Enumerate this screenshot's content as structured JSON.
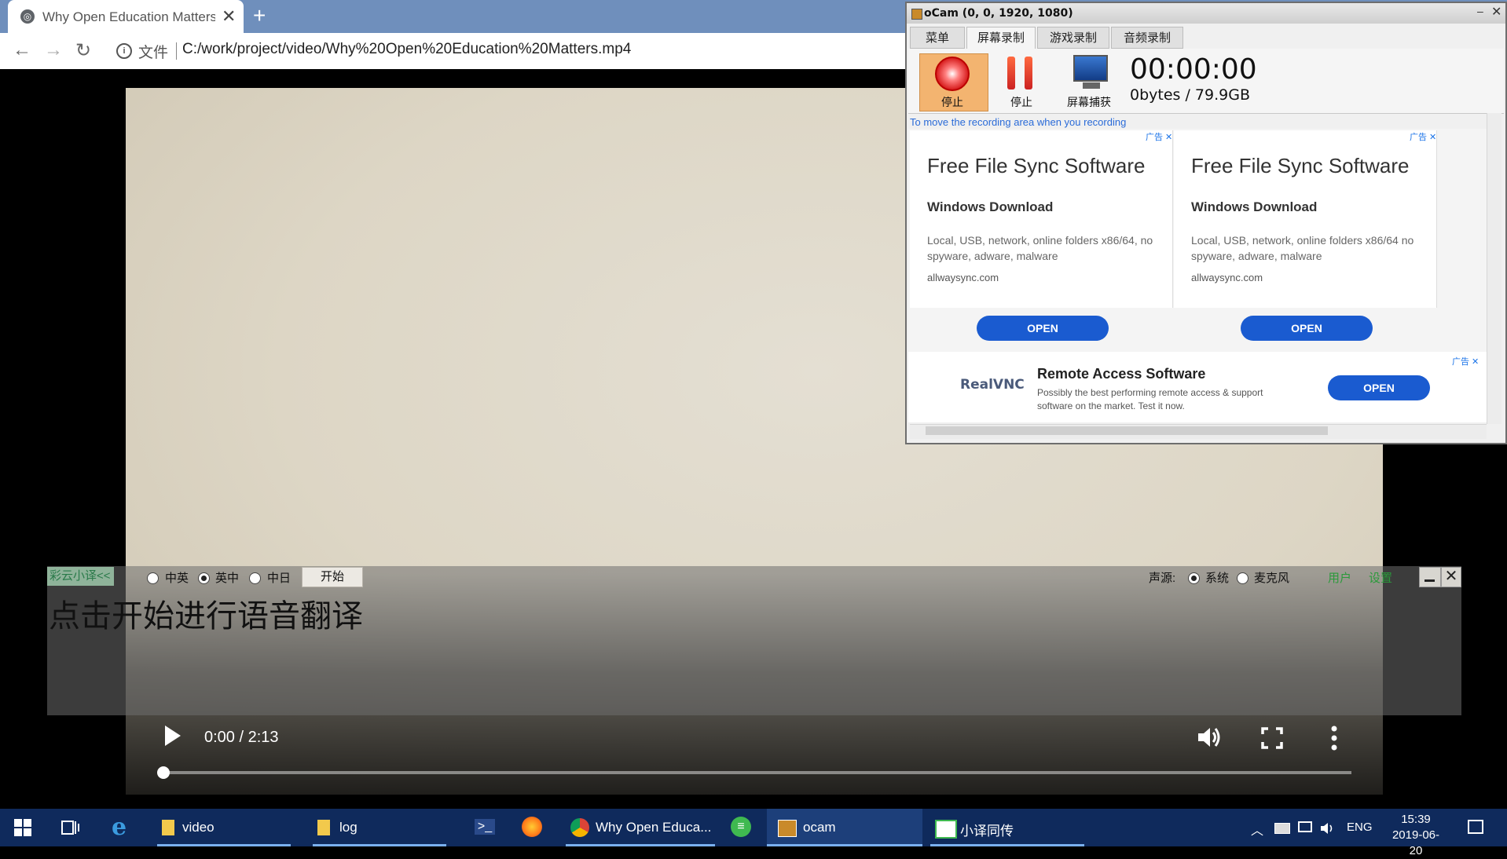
{
  "browser": {
    "tab_title": "Why Open Education Matters",
    "tab_close": "✕",
    "new_tab": "+",
    "file_label": "文件",
    "url": "C:/work/project/video/Why%20Open%20Education%20Matters.mp4",
    "nav": {
      "back": "←",
      "forward": "→",
      "reload": "↻"
    }
  },
  "translator": {
    "logo": "彩云小译<<",
    "options": [
      "中英",
      "英中",
      "中日"
    ],
    "selected_option": "英中",
    "start_label": "开始",
    "sound_label": "声源:",
    "sound_options": [
      "系统",
      "麦克风"
    ],
    "selected_sound": "系统",
    "user_link": "用户",
    "settings_link": "设置",
    "close": "✕",
    "prompt_text": "点击开始进行语音翻译"
  },
  "player": {
    "time": "0:00 / 2:13",
    "progress": 0
  },
  "ocam": {
    "title": "oCam (0, 0, 1920, 1080)",
    "min": "–",
    "close": "✕",
    "tabs": [
      "菜单",
      "屏幕录制",
      "游戏录制",
      "音频录制"
    ],
    "active_tab": "屏幕录制",
    "tools": [
      "停止",
      "停止",
      "屏幕捕获"
    ],
    "timer": "00:00:00",
    "bytes": "0bytes / 79.9GB",
    "hint": "To move the recording area when you recording",
    "ads": [
      {
        "badge": "广告 ✕",
        "title": "Free File Sync Software",
        "subtitle": "Windows Download",
        "desc": "Local, USB, network, online folders x86/64, no spyware, adware, malware",
        "domain": "allwaysync.com",
        "cta": "OPEN"
      },
      {
        "badge": "广告 ✕",
        "title": "Free File Sync Software",
        "subtitle": "Windows Download",
        "desc": "Local, USB, network, online folders x86/64 no spyware, adware, malware",
        "domain": "allwaysync.com",
        "cta": "OPEN"
      }
    ],
    "ad3": {
      "badge": "广告 ✕",
      "logo": "RealVNC",
      "title": "Remote Access Software",
      "desc": "Possibly the best performing remote access & support software on the market. Test it now.",
      "cta": "OPEN"
    }
  },
  "taskbar": {
    "items": [
      "video",
      "log",
      "Why Open Educa...",
      "ocam",
      "小译同传"
    ],
    "lang": "ENG",
    "time": "15:39",
    "date": "2019-06-20"
  },
  "colors": {
    "accent_blue": "#1a5bd0",
    "taskbar": "#0f2a5c",
    "record_red": "#d82020"
  }
}
